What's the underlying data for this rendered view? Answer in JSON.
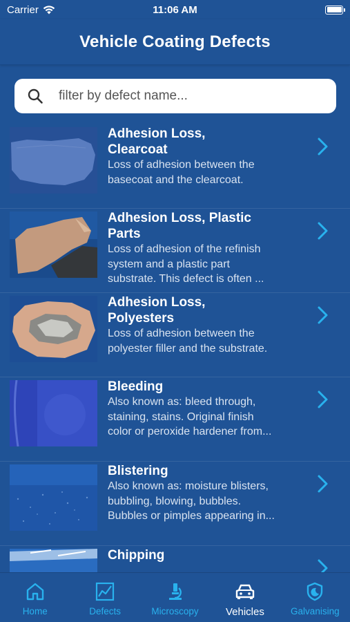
{
  "status": {
    "carrier": "Carrier",
    "time": "11:06 AM"
  },
  "header": {
    "title": "Vehicle Coating Defects"
  },
  "search": {
    "placeholder": "filter by defect name..."
  },
  "defects": [
    {
      "title_lines": [
        "Adhesion Loss,",
        "Clearcoat"
      ],
      "desc_lines": [
        "Loss of adhesion between the",
        "basecoat and the clearcoat."
      ]
    },
    {
      "title_lines": [
        "Adhesion Loss, Plastic",
        "Parts"
      ],
      "desc_lines": [
        "Loss of adhesion of the refinish",
        "system and a plastic part",
        "substrate. This defect is often ..."
      ]
    },
    {
      "title_lines": [
        "Adhesion Loss,",
        "Polyesters"
      ],
      "desc_lines": [
        "Loss of adhesion between the",
        "polyester filler and the substrate."
      ]
    },
    {
      "title_lines": [
        "Bleeding"
      ],
      "desc_lines": [
        "Also known as: bleed through,",
        "staining, stains. Original finish",
        "color or peroxide hardener from..."
      ]
    },
    {
      "title_lines": [
        "Blistering"
      ],
      "desc_lines": [
        "Also known as: moisture blisters,",
        "bubbling, blowing, bubbles.",
        "Bubbles or pimples appearing in..."
      ]
    },
    {
      "title_lines": [
        "Chipping"
      ],
      "desc_lines": []
    }
  ],
  "tabs": [
    {
      "label": "Home",
      "icon": "home-icon"
    },
    {
      "label": "Defects",
      "icon": "chart-icon"
    },
    {
      "label": "Microscopy",
      "icon": "microscope-icon"
    },
    {
      "label": "Vehicles",
      "icon": "car-icon",
      "active": true
    },
    {
      "label": "Galvanising",
      "icon": "shield-icon"
    }
  ],
  "colors": {
    "background": "#1f5396",
    "accent": "#29b2ee",
    "text": "#ffffff"
  }
}
